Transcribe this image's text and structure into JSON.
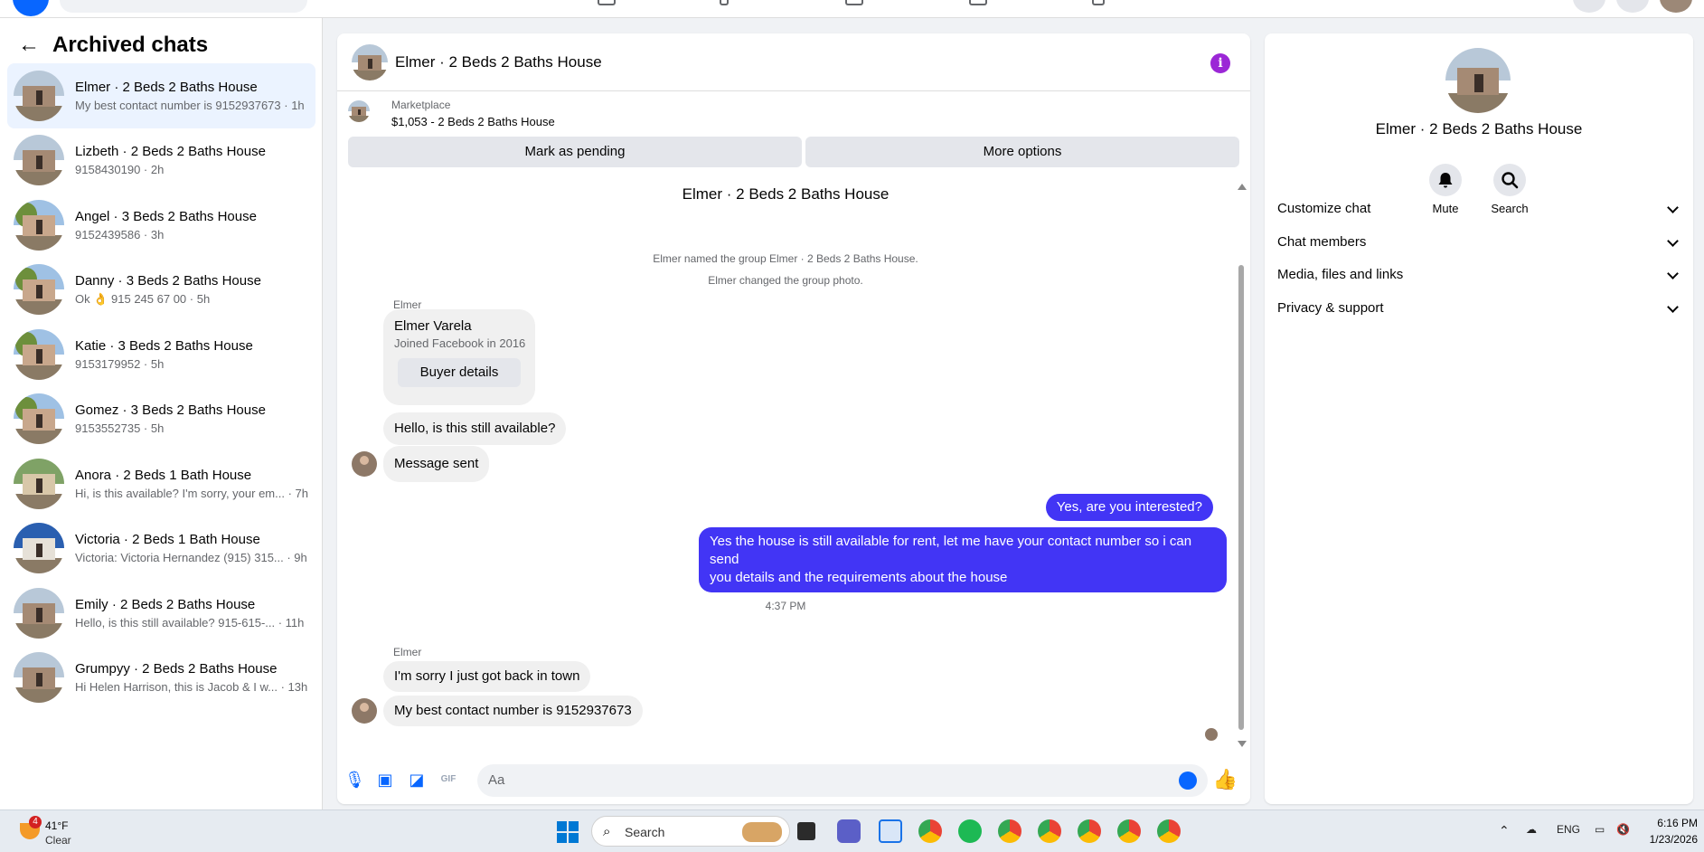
{
  "left_panel": {
    "title": "Archived chats",
    "chats": [
      {
        "title": "Elmer · 2 Beds 2 Baths House",
        "preview": "My best contact number is 9152937673 · 1h",
        "active": true
      },
      {
        "title": "Lizbeth · 2 Beds 2 Baths House",
        "preview": "9158430190 · 2h"
      },
      {
        "title": "Angel · 3 Beds 2 Baths House",
        "preview": "9152439586 · 3h"
      },
      {
        "title": "Danny · 3 Beds 2 Baths House",
        "preview": "Ok 👌 915 245 67 00 · 5h"
      },
      {
        "title": "Katie · 3 Beds 2 Baths House",
        "preview": "9153179952 · 5h"
      },
      {
        "title": "Gomez · 3 Beds 2 Baths House",
        "preview": "9153552735 · 5h"
      },
      {
        "title": "Anora · 2 Beds 1 Bath House",
        "preview": "Hi, is this available? I'm sorry, your em... · 7h"
      },
      {
        "title": "Victoria · 2 Beds 1 Bath House",
        "preview": "Victoria: Victoria Hernandez (915) 315... · 9h"
      },
      {
        "title": "Emily · 2 Beds 2 Baths House",
        "preview": "Hello, is this still available? 915-615-... · 11h"
      },
      {
        "title": "Grumpyy · 2 Beds 2 Baths House",
        "preview": "Hi Helen Harrison, this is Jacob & I w... · 13h"
      }
    ]
  },
  "conversation": {
    "header_name": "Elmer · 2 Beds 2 Baths House",
    "marketplace_label": "Marketplace",
    "listing": "$1,053 - 2 Beds 2 Baths House",
    "mark_pending": "Mark as pending",
    "more_options": "More options",
    "title": "Elmer · 2 Beds 2 Baths House",
    "system_1": "Elmer named the group Elmer · 2 Beds 2 Baths House.",
    "system_2": "Elmer changed the group photo.",
    "sender_1": "Elmer",
    "card_name": "Elmer Varela",
    "card_joined": "Joined Facebook in 2016",
    "card_button": "Buyer details",
    "msg_1": "Hello, is this still available?",
    "msg_2": "Message sent",
    "my_msg_1": "Yes, are you interested?",
    "my_msg_2_line1": "Yes the house is still available for rent, let me have your contact number so i can send",
    "my_msg_2_line2": "you details and the requirements about the house",
    "timestamp": "4:37 PM",
    "sender_2": "Elmer",
    "msg_3": "I'm sorry I just got back in town",
    "msg_4": "My best contact number is 9152937673",
    "composer_placeholder": "Aa"
  },
  "right_panel": {
    "name": "Elmer · 2 Beds 2 Baths House",
    "mute_label": "Mute",
    "search_label": "Search",
    "sections": [
      "Customize chat",
      "Chat members",
      "Media, files and links",
      "Privacy & support"
    ]
  },
  "taskbar": {
    "weather_badge": "4",
    "temperature": "41°F",
    "condition": "Clear",
    "search_label": "Search",
    "language": "ENG",
    "time": "6:16 PM",
    "date": "1/23/2026"
  },
  "icons": {
    "back": "back-arrow-icon",
    "info": "info-icon",
    "mute": "bell-icon",
    "search": "search-icon",
    "mic": "microphone-icon",
    "photo": "photo-icon",
    "sticker": "sticker-icon",
    "gif": "gif-icon",
    "emoji": "emoji-icon",
    "like": "thumbs-up-icon"
  },
  "colors": {
    "accent": "#0866ff",
    "my_bubble": "#4235f5",
    "info_badge": "#9b27d6",
    "active_chat": "#ebf3ff"
  }
}
